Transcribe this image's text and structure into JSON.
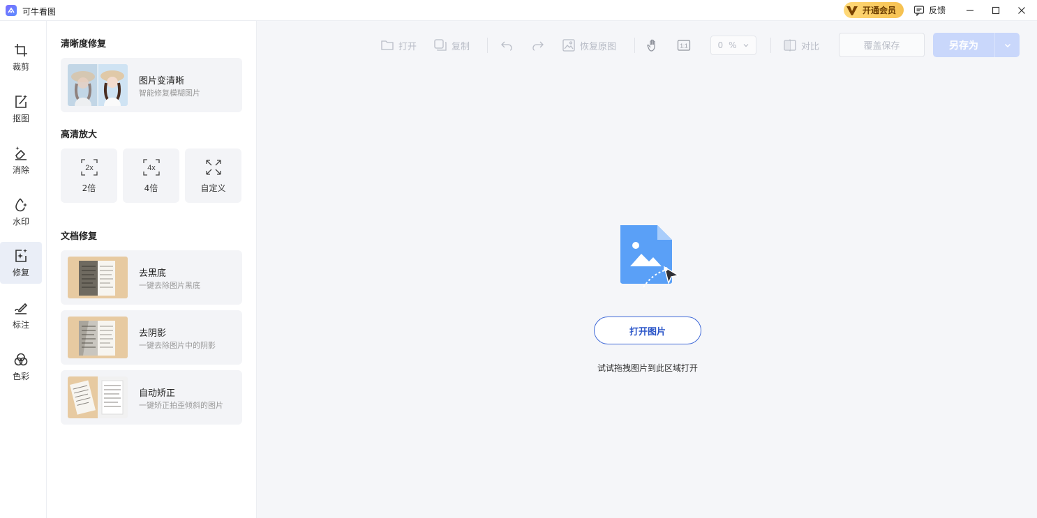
{
  "app": {
    "title": "可牛看图",
    "vip_label": "开通会员",
    "feedback_label": "反馈"
  },
  "nav": {
    "items": [
      {
        "label": "裁剪",
        "icon": "crop-icon"
      },
      {
        "label": "抠图",
        "icon": "cutout-icon"
      },
      {
        "label": "消除",
        "icon": "eraser-icon"
      },
      {
        "label": "水印",
        "icon": "watermark-icon"
      },
      {
        "label": "修复",
        "icon": "repair-icon"
      },
      {
        "label": "标注",
        "icon": "annotate-icon"
      },
      {
        "label": "色彩",
        "icon": "color-icon"
      }
    ],
    "active_index": 4
  },
  "panel": {
    "clarity_title": "清晰度修复",
    "clarity_card": {
      "title": "图片变清晰",
      "subtitle": "智能修复模糊图片"
    },
    "upscale_title": "高清放大",
    "upscale_items": [
      {
        "label": "2倍",
        "glyph": "2x"
      },
      {
        "label": "4倍",
        "glyph": "4x"
      },
      {
        "label": "自定义"
      }
    ],
    "doc_title": "文档修复",
    "doc_cards": [
      {
        "title": "去黑底",
        "subtitle": "一键去除图片黑底"
      },
      {
        "title": "去阴影",
        "subtitle": "一键去除图片中的阴影"
      },
      {
        "title": "自动矫正",
        "subtitle": "一键矫正拍歪倾斜的图片"
      }
    ]
  },
  "toolbar": {
    "open": "打开",
    "copy": "复制",
    "restore": "恢复原图",
    "zoom_value": "0",
    "zoom_unit": "%",
    "ratio_glyph": "1:1",
    "compare": "对比",
    "cover_save": "覆盖保存",
    "save_as": "另存为"
  },
  "main": {
    "open_button": "打开图片",
    "drop_hint": "试试拖拽图片到此区域打开"
  },
  "colors": {
    "accent": "#2a55c8",
    "vip_gold": "#f6c150",
    "main_bg": "#f5f6f9",
    "disabled": "#b8bcc6"
  }
}
